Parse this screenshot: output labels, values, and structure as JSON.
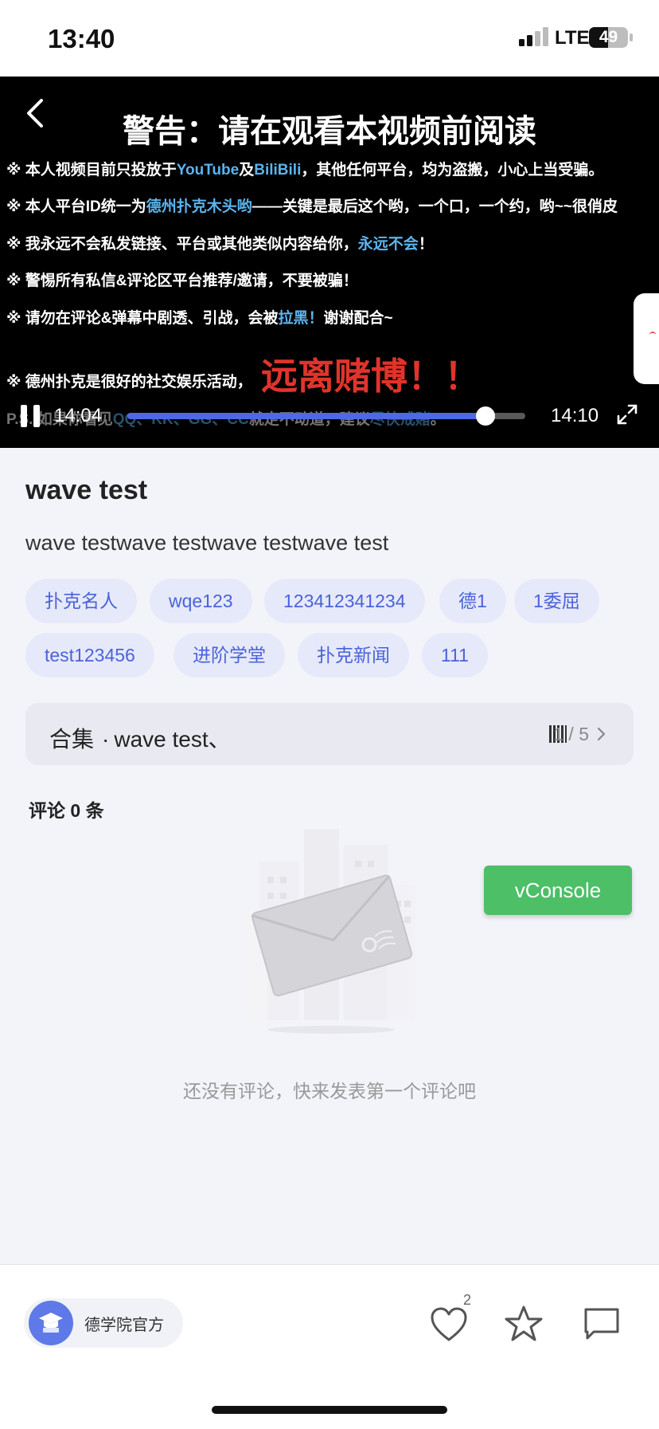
{
  "status_bar": {
    "time": "13:40",
    "network": "LTE",
    "battery": "49",
    "battery_level": 0.49
  },
  "video": {
    "warning_title": "警告：请在观看本视频前阅读",
    "lines": [
      [
        "※  本人视频目前只投放于",
        "YouTube",
        "及",
        "BiliBili",
        "，其他任何平台，均为盗搬，小心上当受骗。"
      ],
      [
        "※  本人平台ID统一为",
        "德州扑克木头哟",
        "——关键是最后这个哟，一个口，一个约，哟~~很俏皮"
      ],
      [
        "※  我永远不会私发链接、平台或其他类似内容给你，",
        "永远不会",
        "！"
      ],
      [
        "※  警惕所有私信&评论区平台推荐/邀请，不要被骗！"
      ],
      [
        "※  请勿在评论&弹幕中剧透、引战，会被",
        "拉黑！",
        "谢谢配合~"
      ],
      [
        "※  德州扑克是很好的社交娱乐活动，"
      ]
    ],
    "red_text": "远离赌博！！",
    "ps_line": [
      "P.S. 如果你看见",
      "QQ、KK、GG、CC",
      "就走不动道，建议",
      "尽快戒赌",
      "。"
    ],
    "current_time": "14:04",
    "duration": "14:10",
    "progress": 0.9
  },
  "content": {
    "title": "wave test",
    "description": "wave testwave testwave testwave test",
    "tags": [
      "扑克名人",
      "wqe123",
      "123412341234",
      "德1",
      "1委屈",
      "test123456",
      "进阶学堂",
      "扑克新闻",
      "111"
    ]
  },
  "collection": {
    "label": "合集",
    "separator": "·",
    "name": "wave test、",
    "count": "1 / 5"
  },
  "comments": {
    "header": "评论 0 条",
    "empty_text": "还没有评论，快来发表第一个评论吧"
  },
  "vconsole_label": "vConsole",
  "bottom": {
    "author_name": "德学院官方",
    "like_count": "2"
  },
  "colors": {
    "accent": "#4a63d8",
    "tag_bg": "#e6e9fa",
    "highlight": "#5bb4ee",
    "vconsole": "#4cbf67",
    "danger": "#e0342b"
  }
}
